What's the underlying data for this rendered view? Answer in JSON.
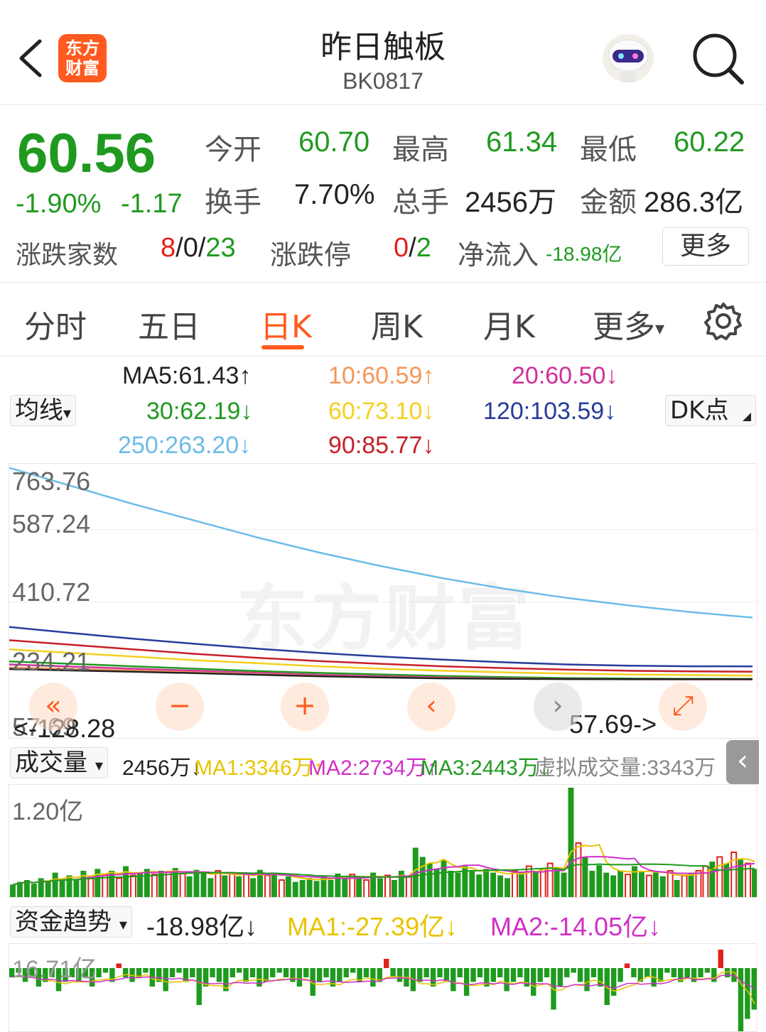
{
  "header": {
    "title": "昨日触板",
    "code": "BK0817",
    "logo_line1": "东方",
    "logo_line2": "财富"
  },
  "quote": {
    "price": "60.56",
    "change_pct": "-1.90%",
    "change": "-1.17",
    "open_label": "今开",
    "open": "60.70",
    "high_label": "最高",
    "high": "61.34",
    "low_label": "最低",
    "low": "60.22",
    "turnover_label": "换手",
    "turnover": "7.70%",
    "volume_label": "总手",
    "volume": "2456万",
    "amount_label": "金额",
    "amount": "286.3亿",
    "breadth_label": "涨跌家数",
    "breadth_up": "8",
    "breadth_flat": "0",
    "breadth_down": "23",
    "sep": "/",
    "limit_label": "涨跌停",
    "limit_up": "0",
    "limit_down": "2",
    "inflow_label": "净流入",
    "inflow": "-18.98亿",
    "more_button": "更多"
  },
  "tabs": [
    "分时",
    "五日",
    "日K",
    "周K",
    "月K",
    "更多"
  ],
  "tab_more_arrow": "▾",
  "ma": {
    "selector": "均线",
    "selector_arrow": "▾",
    "dk_button": "DK点",
    "items": [
      {
        "text": "MA5:61.43↑",
        "color": "#222222"
      },
      {
        "text": "10:60.59↑",
        "color": "#f5965a"
      },
      {
        "text": "20:60.50↓",
        "color": "#d0309a"
      },
      {
        "text": "30:62.19↓",
        "color": "#1f9a1f"
      },
      {
        "text": "60:73.10↓",
        "color": "#f5d020"
      },
      {
        "text": "120:103.59↓",
        "color": "#283c9a"
      },
      {
        "text": "250:263.20↓",
        "color": "#6cbce8"
      },
      {
        "text": "90:85.77↓",
        "color": "#c8202a"
      }
    ]
  },
  "kline": {
    "y_ticks": [
      "763.76",
      "587.24",
      "410.72",
      "234.21",
      "57.69"
    ],
    "min_label": "<-128.28",
    "min_price_label": "57.69->",
    "watermark": "东方财富",
    "controls": [
      "«",
      "−",
      "+",
      "‹",
      "›",
      "⤢"
    ]
  },
  "volume": {
    "selector": "成交量",
    "selector_arrow": "▾",
    "value": "2456万↓",
    "ma1": "MA1:3346万↑",
    "ma2": "MA2:2734万↑",
    "ma3": "MA3:2443万↓",
    "virtual": "虚拟成交量:3343万",
    "y_top": "1.20亿",
    "side_arrow": "‹"
  },
  "fund": {
    "selector": "资金趋势",
    "selector_arrow": "▾",
    "value": "-18.98亿↓",
    "ma1": "MA1:-27.39亿↓",
    "ma2": "MA2:-14.05亿↓",
    "y_top": "16.71亿"
  },
  "chart_data": [
    {
      "type": "line",
      "title": "",
      "ylim": [
        -128.28,
        763.76
      ],
      "series": [
        {
          "name": "250",
          "values": [
            760,
            700,
            640,
            585,
            530,
            480,
            435,
            395,
            360,
            330,
            305,
            283,
            265
          ]
        },
        {
          "name": "120",
          "values": [
            234,
            214,
            195,
            178,
            162,
            148,
            136,
            126,
            117,
            110,
            106,
            104,
            103.6
          ]
        },
        {
          "name": "90",
          "values": [
            190,
            175,
            160,
            145,
            132,
            121,
            112,
            104,
            98,
            93,
            89,
            87,
            85.8
          ]
        },
        {
          "name": "60",
          "values": [
            160,
            148,
            136,
            124,
            114,
            104,
            96,
            89,
            84,
            80,
            77,
            75,
            73.1
          ]
        },
        {
          "name": "30",
          "values": [
            120,
            112,
            104,
            96,
            88,
            82,
            77,
            72,
            68,
            65,
            63.5,
            62.6,
            62.2
          ]
        },
        {
          "name": "20",
          "values": [
            110,
            103,
            96,
            89,
            82,
            76,
            71,
            67,
            64,
            62,
            61,
            60.7,
            60.5
          ]
        },
        {
          "name": "10",
          "values": [
            100,
            95,
            90,
            84,
            78,
            72,
            68,
            65,
            63,
            61.5,
            60.9,
            60.7,
            60.6
          ]
        },
        {
          "name": "MA5",
          "values": [
            95,
            90,
            86,
            81,
            76,
            71,
            67,
            64,
            62.5,
            61.6,
            61.5,
            61.4,
            61.43
          ]
        }
      ]
    },
    {
      "type": "bar",
      "title": "成交量",
      "ylim": [
        0,
        1.2
      ],
      "values": [
        0.15,
        0.18,
        0.2,
        0.16,
        0.22,
        0.19,
        0.28,
        0.21,
        0.25,
        0.2,
        0.3,
        0.24,
        0.32,
        0.26,
        0.3,
        0.22,
        0.35,
        0.25,
        0.28,
        0.32,
        0.26,
        0.3,
        0.29,
        0.33,
        0.27,
        0.24,
        0.31,
        0.28,
        0.22,
        0.3,
        0.25,
        0.27,
        0.24,
        0.26,
        0.22,
        0.31,
        0.25,
        0.28,
        0.2,
        0.24,
        0.18,
        0.2,
        0.22,
        0.19,
        0.24,
        0.2,
        0.27,
        0.22,
        0.26,
        0.23,
        0.2,
        0.28,
        0.22,
        0.25,
        0.2,
        0.3,
        0.24,
        0.55,
        0.45,
        0.38,
        0.32,
        0.42,
        0.3,
        0.28,
        0.35,
        0.3,
        0.26,
        0.32,
        0.28,
        0.25,
        0.22,
        0.3,
        0.28,
        0.35,
        0.3,
        0.32,
        0.38,
        0.34,
        0.28,
        1.2,
        0.6,
        0.45,
        0.3,
        0.36,
        0.28,
        0.25,
        0.3,
        0.26,
        0.35,
        0.3,
        0.25,
        0.28,
        0.24,
        0.3,
        0.2,
        0.25,
        0.28,
        0.3,
        0.35,
        0.4,
        0.45,
        0.38,
        0.5,
        0.42,
        0.38,
        0.32
      ],
      "up": [
        0,
        0,
        0,
        0,
        0,
        0,
        0,
        0,
        0,
        0,
        0,
        1,
        0,
        1,
        0,
        1,
        0,
        1,
        0,
        0,
        1,
        0,
        1,
        0,
        1,
        0,
        0,
        0,
        0,
        1,
        0,
        1,
        0,
        1,
        0,
        0,
        1,
        0,
        1,
        0,
        0,
        0,
        0,
        0,
        0,
        0,
        0,
        0,
        1,
        0,
        1,
        0,
        0,
        1,
        0,
        0,
        1,
        0,
        0,
        0,
        0,
        0,
        0,
        0,
        0,
        0,
        0,
        0,
        0,
        0,
        0,
        1,
        0,
        1,
        0,
        1,
        1,
        0,
        0,
        0,
        1,
        0,
        0,
        0,
        0,
        0,
        0,
        1,
        0,
        0,
        1,
        0,
        0,
        1,
        0,
        1,
        0,
        1,
        1,
        0,
        1,
        0,
        1,
        0,
        1,
        0
      ]
    },
    {
      "type": "bar",
      "title": "资金趋势",
      "ylim": [
        -16.71,
        16.71
      ],
      "values": [
        -2,
        -1,
        -3,
        -2,
        -4,
        -3,
        -2,
        -5,
        -3,
        -2,
        -3,
        -2,
        -4,
        -2,
        -1,
        -3,
        1,
        -2,
        -3,
        -2,
        -1,
        -4,
        -3,
        -5,
        -2,
        -1,
        -3,
        -2,
        -8,
        -4,
        -2,
        -3,
        -5,
        -2,
        -1,
        -3,
        -2,
        -4,
        -3,
        -2,
        -1,
        -2,
        -3,
        -4,
        -2,
        -6,
        -3,
        -2,
        -4,
        -3,
        -2,
        -1,
        -3,
        -2,
        -4,
        -3,
        2,
        -2,
        -3,
        -4,
        -5,
        -3,
        -2,
        -4,
        -2,
        -3,
        -5,
        -2,
        -6,
        -3,
        -2,
        -4,
        -3,
        -2,
        -5,
        -3,
        -2,
        -4,
        -6,
        -3,
        -2,
        -9,
        -4,
        -2,
        -1,
        -3,
        -5,
        -2,
        -4,
        -8,
        -6,
        -3,
        1,
        -2,
        -3,
        -2,
        -4,
        -3,
        -1,
        -2,
        -3,
        -2,
        -3,
        -2,
        -1,
        -3,
        4,
        -2,
        -3,
        -14,
        -11,
        -9
      ]
    }
  ]
}
